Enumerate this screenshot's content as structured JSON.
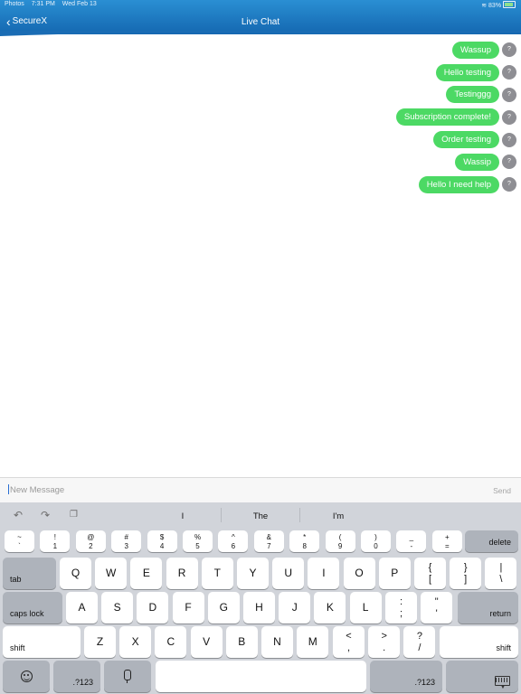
{
  "status_bar": {
    "app": "Photos",
    "time": "7:31 PM",
    "date": "Wed Feb 13",
    "battery": "83%"
  },
  "nav": {
    "back_label": "SecureX",
    "title": "Live Chat"
  },
  "messages": [
    {
      "text": "Wassup",
      "status": "?"
    },
    {
      "text": "Hello testing",
      "status": "?"
    },
    {
      "text": "Testinggg",
      "status": "?"
    },
    {
      "text": "Subscription complete!",
      "status": "?"
    },
    {
      "text": "Order testing",
      "status": "?"
    },
    {
      "text": "Wassip",
      "status": "?"
    },
    {
      "text": "Hello I need help",
      "status": "?"
    }
  ],
  "composer": {
    "placeholder": "New Message",
    "send_label": "Send"
  },
  "keyboard": {
    "suggestions": [
      "I",
      "The",
      "I'm"
    ],
    "number_row": [
      {
        "top": "~",
        "bot": "`"
      },
      {
        "top": "!",
        "bot": "1"
      },
      {
        "top": "@",
        "bot": "2"
      },
      {
        "top": "#",
        "bot": "3"
      },
      {
        "top": "$",
        "bot": "4"
      },
      {
        "top": "%",
        "bot": "5"
      },
      {
        "top": "^",
        "bot": "6"
      },
      {
        "top": "&",
        "bot": "7"
      },
      {
        "top": "*",
        "bot": "8"
      },
      {
        "top": "(",
        "bot": "9"
      },
      {
        "top": ")",
        "bot": "0"
      },
      {
        "top": "_",
        "bot": "-"
      },
      {
        "top": "+",
        "bot": "="
      }
    ],
    "delete_label": "delete",
    "tab_label": "tab",
    "row_q": [
      "Q",
      "W",
      "E",
      "R",
      "T",
      "Y",
      "U",
      "I",
      "O",
      "P"
    ],
    "row_q_extra": [
      {
        "top": "{",
        "bot": "["
      },
      {
        "top": "}",
        "bot": "]"
      },
      {
        "top": "|",
        "bot": "\\"
      }
    ],
    "caps_label": "caps lock",
    "row_a": [
      "A",
      "S",
      "D",
      "F",
      "G",
      "H",
      "J",
      "K",
      "L"
    ],
    "row_a_extra": [
      {
        "top": ":",
        "bot": ";"
      },
      {
        "top": "\"",
        "bot": "'"
      }
    ],
    "return_label": "return",
    "shift_label": "shift",
    "row_z": [
      "Z",
      "X",
      "C",
      "V",
      "B",
      "N",
      "M"
    ],
    "row_z_extra": [
      {
        "top": "<",
        "bot": ","
      },
      {
        "top": ">",
        "bot": "."
      },
      {
        "top": "?",
        "bot": "/"
      }
    ],
    "numbers_label": ".?123"
  }
}
